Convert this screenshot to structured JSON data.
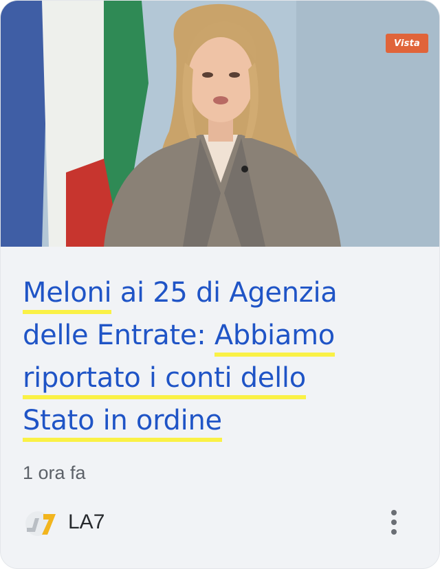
{
  "card": {
    "thumbnail": {
      "watermark": "Vista",
      "alt_icon": "news-photo"
    },
    "headline": {
      "lines": [
        "Meloni ai 25 di Agenzia",
        "delle Entrate: Abbiamo",
        "riportato i conti dello",
        "Stato in ordine"
      ],
      "highlighted_segments": [
        "Meloni",
        "Abbiamo",
        "riportato i conti dello",
        "Stato in ordine"
      ]
    },
    "timestamp": "1 ora fa",
    "source": {
      "name": "LA7",
      "logo_icon": "la7-logo-icon"
    },
    "more_menu_icon": "more-vert-icon",
    "colors": {
      "headline": "#1f54c6",
      "highlight": "#faf03c",
      "card_background": "#f1f3f6",
      "watermark": "#e0643a"
    }
  }
}
